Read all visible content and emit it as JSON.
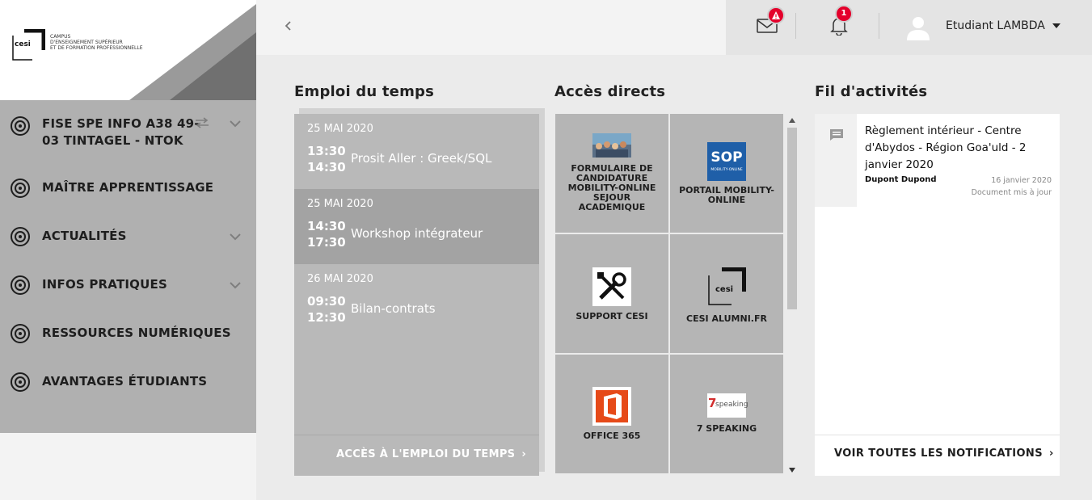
{
  "logo": {
    "word": "cesi",
    "lines": [
      "Campus",
      "d'enseignement supérieur",
      "et de formation professionnelle"
    ]
  },
  "sidebar": {
    "items": [
      {
        "label": "FISE SPE INFO A38 49-",
        "label2": "03 TINTAGEL - NTOK",
        "icon": "target-icon",
        "has_swap": true,
        "has_chevron": true
      },
      {
        "label": "MAÎTRE APPRENTISSAGE",
        "icon": "target-icon",
        "has_chevron": false
      },
      {
        "label": "ACTUALITÉS",
        "icon": "target-icon",
        "has_chevron": true
      },
      {
        "label": "INFOS PRATIQUES",
        "icon": "target-icon",
        "has_chevron": true
      },
      {
        "label": "RESSOURCES NUMÉRIQUES",
        "icon": "target-icon",
        "has_chevron": false
      },
      {
        "label": "AVANTAGES ÉTUDIANTS",
        "icon": "target-icon",
        "has_chevron": false
      }
    ]
  },
  "topbar": {
    "mail_badge": "!",
    "bell_badge": "1",
    "user_name": "Etudiant LAMBDA"
  },
  "schedule": {
    "title": "Emploi du temps",
    "events": [
      {
        "date": "25 MAI 2020",
        "start": "13:30",
        "end": "14:30",
        "title": "Prosit Aller : Greek/SQL",
        "active": false
      },
      {
        "date": "25 MAI 2020",
        "start": "14:30",
        "end": "17:30",
        "title": "Workshop intégrateur",
        "active": true
      },
      {
        "date": "26 MAI 2020",
        "start": "09:30",
        "end": "12:30",
        "title": "Bilan-contrats",
        "active": false
      }
    ],
    "link": "ACCÈS À L'EMPLOI DU TEMPS"
  },
  "access": {
    "title": "Accès directs",
    "tiles": [
      {
        "label": "FORMULAIRE DE CANDIDATURE MOBILITY-ONLINE SEJOUR ACADEMIQUE",
        "icon": "crowd-photo-icon"
      },
      {
        "label": "PORTAIL MOBILITY-ONLINE",
        "icon": "sop-logo-icon",
        "logo_text": "SOP",
        "logo_sub": "MOBILITY-ONLINE"
      },
      {
        "label": "SUPPORT CESI",
        "icon": "tools-icon"
      },
      {
        "label": "CESI ALUMNI.FR",
        "icon": "cesi-logo-icon",
        "logo_text": "cesi"
      },
      {
        "label": "OFFICE 365",
        "icon": "office-icon"
      },
      {
        "label": "7 SPEAKING",
        "icon": "7speaking-icon",
        "logo_num": "7",
        "logo_text": "speaking"
      }
    ]
  },
  "feed": {
    "title": "Fil d'activités",
    "item": {
      "title": "Règlement intérieur - Centre d'Abydos - Région Goa'uld - 2 janvier 2020",
      "author": "Dupont Dupond",
      "date": "16 janvier 2020",
      "status": "Document mis à jour"
    },
    "link": "VOIR TOUTES LES NOTIFICATIONS"
  },
  "colors": {
    "sidebar_nav": "#b0b0b0",
    "schedule_bg": "#b9b9b9",
    "schedule_active": "#a3a3a3",
    "badge": "#e4002b"
  }
}
